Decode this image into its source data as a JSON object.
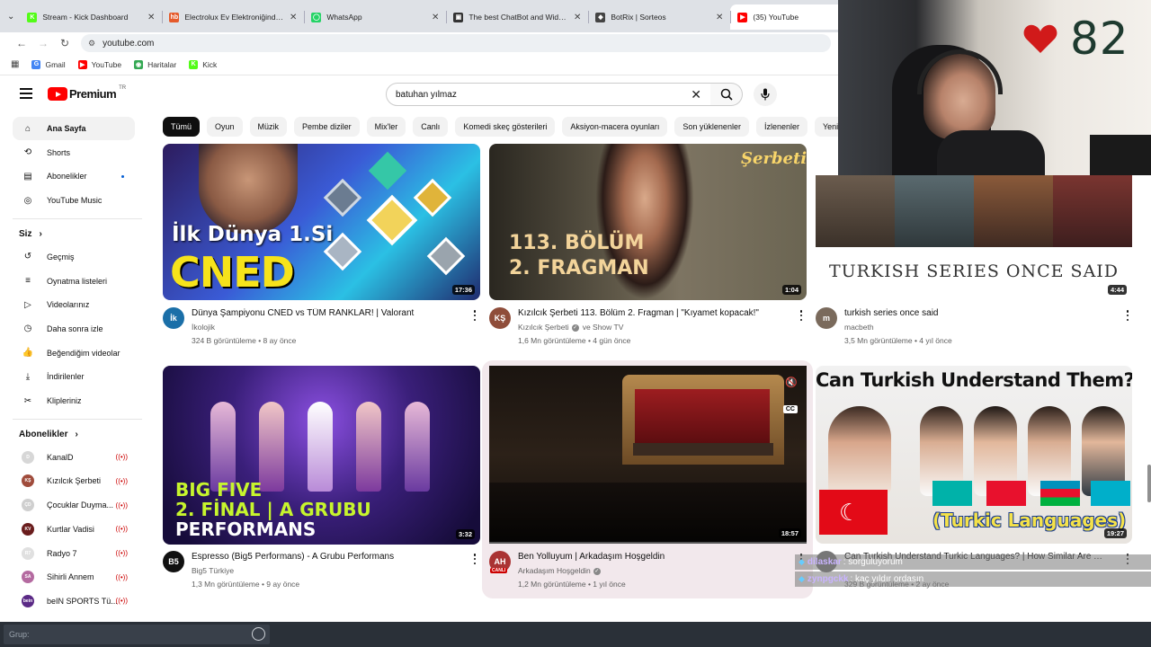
{
  "browser": {
    "tabs": [
      {
        "title": "Stream - Kick Dashboard",
        "favicon_color": "#53fc18",
        "favicon_text": "K",
        "active": false
      },
      {
        "title": "Electrolux Ev Elektroniğinde Ka",
        "favicon_color": "#e55a2b",
        "favicon_text": "hb",
        "active": false
      },
      {
        "title": "WhatsApp",
        "favicon_color": "#25d366",
        "favicon_text": "◯",
        "active": false
      },
      {
        "title": "The best ChatBot and Widgets",
        "favicon_color": "#333333",
        "favicon_text": "▣",
        "active": false
      },
      {
        "title": "BotRix | Sorteos",
        "favicon_color": "#444444",
        "favicon_text": "◆",
        "active": false
      },
      {
        "title": "(35) YouTube",
        "favicon_color": "#ff0000",
        "favicon_text": "▶",
        "active": true
      }
    ],
    "url": "youtube.com",
    "bookmarks": [
      {
        "label": "Gmail",
        "icon_text": "G",
        "color": "#4285f4"
      },
      {
        "label": "YouTube",
        "icon_text": "▶",
        "color": "#ff0000"
      },
      {
        "label": "Haritalar",
        "icon_text": "◉",
        "color": "#34a853"
      },
      {
        "label": "Kick",
        "icon_text": "K",
        "color": "#53fc18"
      }
    ]
  },
  "youtube": {
    "logo_text": "Premium",
    "country_code": "TR",
    "search_query": "batuhan yılmaz",
    "sidebar": {
      "main": [
        {
          "label": "Ana Sayfa",
          "icon": "home-icon",
          "glyph": "⌂"
        },
        {
          "label": "Shorts",
          "icon": "shorts-icon",
          "glyph": "⟲"
        },
        {
          "label": "Abonelikler",
          "icon": "subscriptions-icon",
          "glyph": "▤"
        },
        {
          "label": "YouTube Music",
          "icon": "music-icon",
          "glyph": "◎"
        }
      ],
      "you_title": "Siz",
      "you": [
        {
          "label": "Geçmiş",
          "icon": "history-icon",
          "glyph": "↺"
        },
        {
          "label": "Oynatma listeleri",
          "icon": "playlists-icon",
          "glyph": "≡"
        },
        {
          "label": "Videolarınız",
          "icon": "your-videos-icon",
          "glyph": "▷"
        },
        {
          "label": "Daha sonra izle",
          "icon": "watch-later-icon",
          "glyph": "◷"
        },
        {
          "label": "Beğendiğim videolar",
          "icon": "liked-icon",
          "glyph": "👍"
        },
        {
          "label": "İndirilenler",
          "icon": "downloads-icon",
          "glyph": "⤓"
        },
        {
          "label": "Klipleriniz",
          "icon": "clips-icon",
          "glyph": "✂"
        }
      ],
      "subs_title": "Abonelikler",
      "subscriptions": [
        {
          "label": "KanalD",
          "color": "#d7d7d7",
          "text": "D"
        },
        {
          "label": "Kızılcık Şerbeti",
          "color": "#a04c3c",
          "text": "KŞ"
        },
        {
          "label": "Çocuklar Duyma...",
          "color": "#cfcfcf",
          "text": "ÇD"
        },
        {
          "label": "Kurtlar Vadisi",
          "color": "#6a1d1d",
          "text": "KV"
        },
        {
          "label": "Radyo 7",
          "color": "#e0e0e0",
          "text": "R7"
        },
        {
          "label": "Sihirli Annem",
          "color": "#b46aa0",
          "text": "SA"
        },
        {
          "label": "beIN SPORTS Tü...",
          "color": "#5b2a86",
          "text": "bein"
        }
      ]
    },
    "chips": [
      "Tümü",
      "Oyun",
      "Müzik",
      "Pembe diziler",
      "Mix'ler",
      "Canlı",
      "Komedi skeç gösterileri",
      "Aksiyon-macera oyunları",
      "Son yüklenenler",
      "İzlenenler",
      "Yeni"
    ],
    "videos": [
      {
        "title": "Dünya Şampiyonu CNED vs TÜM RANKLAR! | Valorant",
        "channel": "İkolojik",
        "verified": false,
        "meta": "324 B görüntüleme • 8 ay önce",
        "duration": "17:36",
        "thumb_text": "İlk Dünya 1.Si",
        "thumb_text2": "CNED",
        "avatar_text": "İk",
        "avatar_color": "#1b6fa8"
      },
      {
        "title": "Kızılcık Şerbeti 113. Bölüm 2. Fragman | \"Kıyamet kopacak!\"",
        "channel": "Kızılcık Şerbeti",
        "channel_extra": "ve Show TV",
        "verified": true,
        "meta": "1,6 Mn görüntüleme • 4 gün önce",
        "duration": "1:04",
        "thumb_text": "113. BÖLÜM",
        "thumb_text2": "2. FRAGMAN",
        "thumb_text3": "Şerbeti",
        "avatar_text": "KŞ",
        "avatar_color": "#8f4d3a"
      },
      {
        "title": "turkish series once said",
        "channel": "macbeth",
        "verified": false,
        "meta": "3,5 Mn görüntüleme • 4 yıl önce",
        "duration": "4:44",
        "thumb_text": "TURKISH SERIES ONCE SAID",
        "avatar_text": "m",
        "avatar_color": "#7a6a5c"
      },
      {
        "title": "Espresso (Big5 Performans) - A Grubu Performans",
        "channel": "Big5 Türkiye",
        "verified": false,
        "meta": "1,3 Mn görüntüleme • 9 ay önce",
        "duration": "3:32",
        "thumb_text": "BIG FIVE",
        "thumb_text2": "2. FİNAL | A GRUBU",
        "thumb_text3": "PERFORMANS",
        "avatar_text": "B5",
        "avatar_color": "#111111"
      },
      {
        "title": "Ben Yolluyum | Arkadaşım Hoşgeldin",
        "channel": "Arkadaşım Hoşgeldin",
        "verified": true,
        "meta": "1,2 Mn görüntüleme • 1 yıl önce",
        "duration": "18:57",
        "live_badge": "CANLI",
        "avatar_text": "AH",
        "avatar_color": "#a33"
      },
      {
        "title": "Can Turkish Understand Turkic Languages? | How Similar Are They?",
        "channel": "",
        "verified": false,
        "meta": "329 B görüntüleme • 2 ay önce",
        "duration": "19:27",
        "thumb_text": "Can Turkish Understand Them?",
        "thumb_text_highlight": "Turkish",
        "thumb_text2": "(Turkic Languages)",
        "avatar_text": "",
        "avatar_color": "#777"
      }
    ]
  },
  "overlay": {
    "heart_count": "82",
    "chat": [
      {
        "user": "dilaskar",
        "message": ": sorguluyorum"
      },
      {
        "user": "zynpgckk",
        "message": ": kaç yıldır ordasın"
      }
    ],
    "group_placeholder": "Grup:"
  }
}
